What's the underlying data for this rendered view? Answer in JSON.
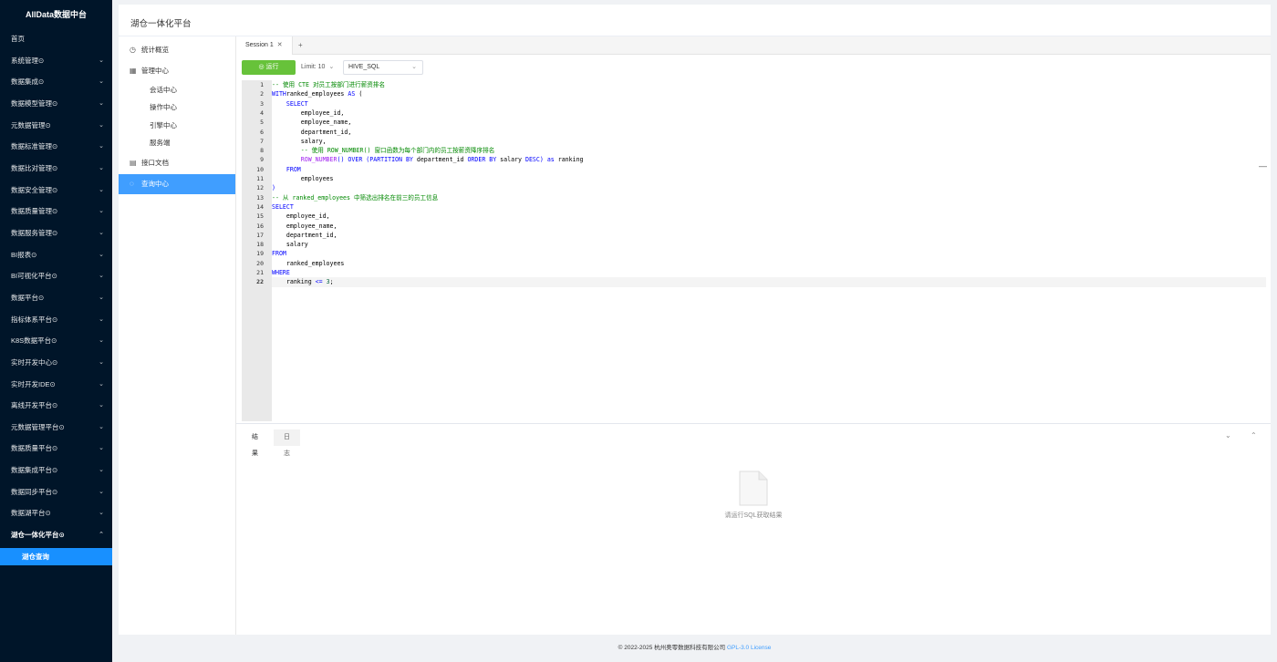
{
  "sidebar": {
    "brand": "AllData数据中台",
    "items": [
      {
        "label": "首页",
        "chevron": ""
      },
      {
        "label": "系统管理⊙",
        "chevron": "⌄"
      },
      {
        "label": "数据集成⊙",
        "chevron": "⌄"
      },
      {
        "label": "数据模型管理⊙",
        "chevron": "⌄"
      },
      {
        "label": "元数据管理⊙",
        "chevron": "⌄"
      },
      {
        "label": "数据标准管理⊙",
        "chevron": "⌄"
      },
      {
        "label": "数据比对管理⊙",
        "chevron": "⌄"
      },
      {
        "label": "数据安全管理⊙",
        "chevron": "⌄"
      },
      {
        "label": "数据质量管理⊙",
        "chevron": "⌄"
      },
      {
        "label": "数据服务管理⊙",
        "chevron": "⌄"
      },
      {
        "label": "BI报表⊙",
        "chevron": "⌄"
      },
      {
        "label": "BI可视化平台⊙",
        "chevron": "⌄"
      },
      {
        "label": "数据平台⊙",
        "chevron": "⌄"
      },
      {
        "label": "指标体系平台⊙",
        "chevron": "⌄"
      },
      {
        "label": "K8S数据平台⊙",
        "chevron": "⌄"
      },
      {
        "label": "实时开发中心⊙",
        "chevron": "⌄"
      },
      {
        "label": "实时开发IDE⊙",
        "chevron": "⌄"
      },
      {
        "label": "离线开发平台⊙",
        "chevron": "⌄"
      },
      {
        "label": "元数据管理平台⊙",
        "chevron": "⌄"
      },
      {
        "label": "数据质量平台⊙",
        "chevron": "⌄"
      },
      {
        "label": "数据集成平台⊙",
        "chevron": "⌄"
      },
      {
        "label": "数据同步平台⊙",
        "chevron": "⌄"
      },
      {
        "label": "数据湖平台⊙",
        "chevron": "⌄"
      },
      {
        "label": "湖仓一体化平台⊙",
        "chevron": "⌃"
      }
    ],
    "active_sub": "湖仓查询"
  },
  "header": {
    "title": "湖仓一体化平台"
  },
  "left_menu": {
    "overview": "统计概览",
    "management": "管理中心",
    "subs": [
      "会话中心",
      "操作中心",
      "引擎中心",
      "服务端"
    ],
    "api_docs": "接口文档",
    "query_center": "查询中心"
  },
  "tabs": {
    "session": "Session 1",
    "close": "✕",
    "add": "+"
  },
  "toolbar": {
    "run": "运行",
    "limit": "Limit: 10",
    "dialect": "HIVE_SQL",
    "dropdown": "⌄"
  },
  "editor": {
    "line_numbers": [
      "1",
      "2",
      "3",
      "4",
      "5",
      "6",
      "7",
      "8",
      "9",
      "10",
      "11",
      "12",
      "13",
      "14",
      "15",
      "16",
      "17",
      "18",
      "19",
      "20",
      "21",
      "22"
    ],
    "collapse": "—"
  },
  "results": {
    "tab_result": "结果",
    "tab_log": "日志",
    "collapse": "⌄",
    "expand": "⌃",
    "empty_text": "请运行SQL获取结果"
  },
  "footer": {
    "copyright": "© 2022-2025 杭州奥零数据科技有限公司",
    "license": "GPL-3.0 License"
  },
  "colors": {
    "sidebar_bg": "#001529",
    "accent": "#409eff",
    "run_green": "#67c23a",
    "active_sub": "#1890ff"
  }
}
